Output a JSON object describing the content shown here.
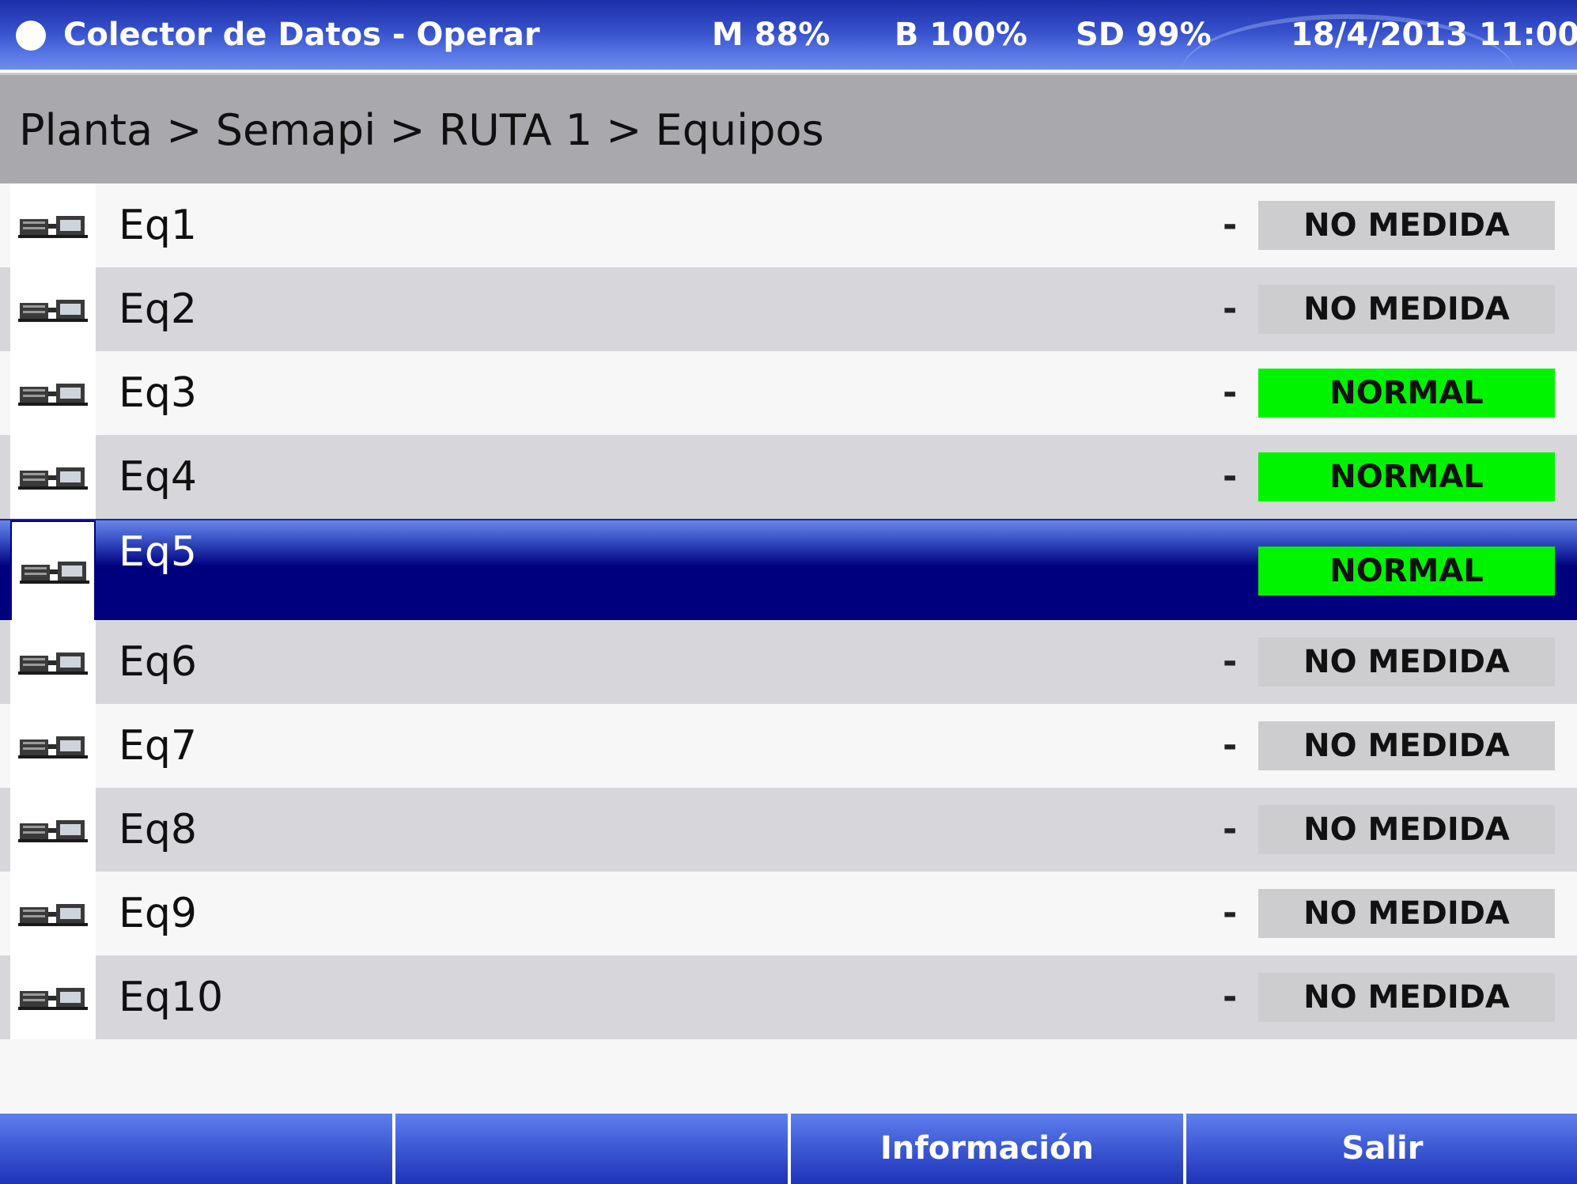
{
  "titlebar": {
    "title": "Colector de Datos - Operar",
    "memory": "M 88%",
    "battery": "B 100%",
    "sd": "SD 99%",
    "datetime": "18/4/2013 11:00"
  },
  "breadcrumb": {
    "path": "Planta > Semapi > RUTA 1 > Equipos"
  },
  "equipment": [
    {
      "name": "Eq1",
      "value": "-",
      "status": "NO MEDIDA",
      "status_type": "gray"
    },
    {
      "name": "Eq2",
      "value": "-",
      "status": "NO MEDIDA",
      "status_type": "gray"
    },
    {
      "name": "Eq3",
      "value": "-",
      "status": "NORMAL",
      "status_type": "green"
    },
    {
      "name": "Eq4",
      "value": "-",
      "status": "NORMAL",
      "status_type": "green"
    },
    {
      "name": "Eq5",
      "value": "",
      "status": "NORMAL",
      "status_type": "green",
      "selected": true
    },
    {
      "name": "Eq6",
      "value": "-",
      "status": "NO MEDIDA",
      "status_type": "gray"
    },
    {
      "name": "Eq7",
      "value": "-",
      "status": "NO MEDIDA",
      "status_type": "gray"
    },
    {
      "name": "Eq8",
      "value": "-",
      "status": "NO MEDIDA",
      "status_type": "gray"
    },
    {
      "name": "Eq9",
      "value": "-",
      "status": "NO MEDIDA",
      "status_type": "gray"
    },
    {
      "name": "Eq10",
      "value": "-",
      "status": "NO MEDIDA",
      "status_type": "gray"
    }
  ],
  "footer": {
    "button1": "",
    "button2": "",
    "button3": "Información",
    "button4": "Salir"
  },
  "icons": {
    "status": "circle-icon",
    "equipment": "motor-pump-icon"
  },
  "colors": {
    "selected_row": "#00007f",
    "normal": "#00f400",
    "no_medida": "#cdcccf"
  }
}
